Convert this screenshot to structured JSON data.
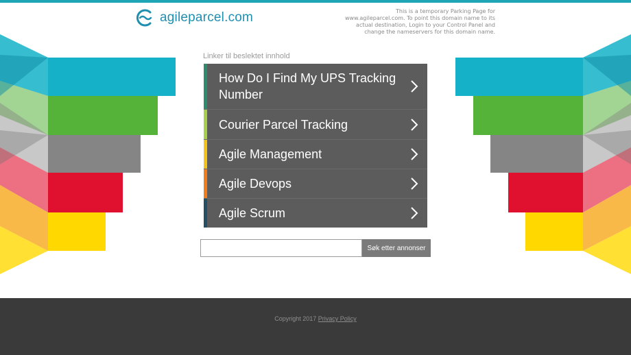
{
  "brand": {
    "domain": "agileparcel.com",
    "accent_color": "#1e8fb0"
  },
  "notice": {
    "lines": [
      "This is a temporary Parking Page for",
      "www.agileparcel.com. To point this domain name to its",
      "actual destination, Login to your Control Panel and",
      "change the nameservers for this domain name."
    ]
  },
  "related": {
    "title": "Linker til beslektet innhold",
    "items": [
      {
        "label": "How Do I Find My UPS Tracking Number",
        "accent": "#2e8b6f",
        "icon": "chevron-right-icon"
      },
      {
        "label": "Courier Parcel Tracking",
        "accent": "#a7cf4a",
        "icon": "chevron-right-icon"
      },
      {
        "label": "Agile Management",
        "accent": "#f2c31b",
        "icon": "chevron-right-icon"
      },
      {
        "label": "Agile Devops",
        "accent": "#f07c1d",
        "icon": "chevron-right-icon"
      },
      {
        "label": "Agile Scrum",
        "accent": "#244f66",
        "icon": "chevron-right-icon"
      }
    ]
  },
  "search": {
    "value": "",
    "placeholder": "",
    "button_label": "Søk etter annonser"
  },
  "footer": {
    "copyright": "Copyright 2017",
    "privacy_label": "Privacy Policy"
  },
  "decor_colors": {
    "teal": "#14b1c8",
    "green": "#55b33a",
    "gray": "#858585",
    "red": "#e0102f",
    "yellow": "#ffd800"
  }
}
